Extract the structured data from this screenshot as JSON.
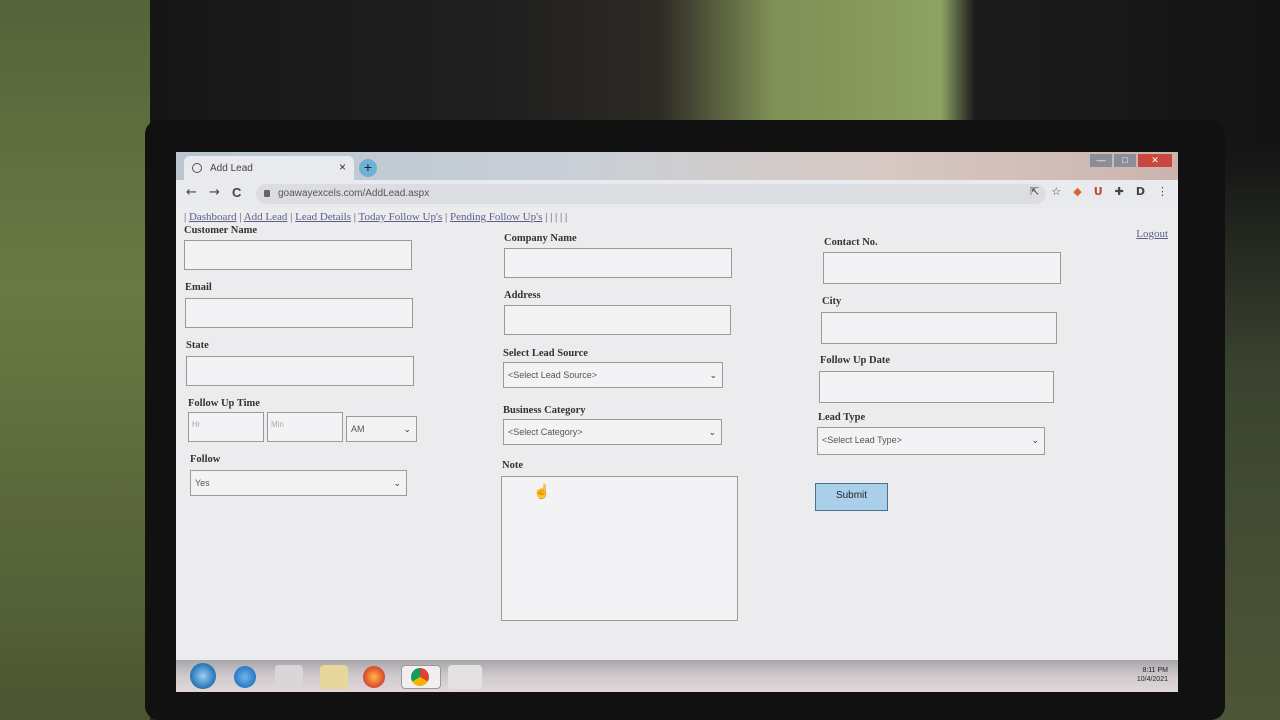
{
  "browser": {
    "tab_title": "Add Lead",
    "tab_close": "×",
    "new_tab": "+",
    "url": "goawayexcels.com/AddLead.aspx",
    "nav": {
      "back": "←",
      "forward": "→",
      "reload": "C"
    },
    "window_controls": {
      "minimize": "—",
      "maximize": "□",
      "close": "✕"
    }
  },
  "menu": {
    "leading_sep": "|",
    "items": [
      "Dashboard",
      "Add Lead",
      "Lead Details",
      "Today Follow Up's",
      "Pending Follow Up's"
    ],
    "trailing": "| | | | |"
  },
  "logout_label": "Logout",
  "form": {
    "customer_name_label": "Customer Name",
    "company_name_label": "Company Name",
    "contact_no_label": "Contact No.",
    "email_label": "Email",
    "address_label": "Address",
    "city_label": "City",
    "state_label": "State",
    "lead_source_label": "Select Lead Source",
    "lead_source_value": "<Select Lead Source>",
    "follow_up_date_label": "Follow Up Date",
    "follow_up_time_label": "Follow Up Time",
    "hour_placeholder": "Hr",
    "minute_placeholder": "Min",
    "ampm_value": "AM",
    "business_category_label": "Business Category",
    "business_category_value": "<Select Category>",
    "lead_type_label": "Lead Type",
    "lead_type_value": "<Select Lead Type>",
    "follow_label": "Follow",
    "follow_value": "Yes",
    "note_label": "Note",
    "submit_label": "Submit"
  },
  "tray": {
    "time": "8:11 PM",
    "date": "10/4/2021"
  }
}
